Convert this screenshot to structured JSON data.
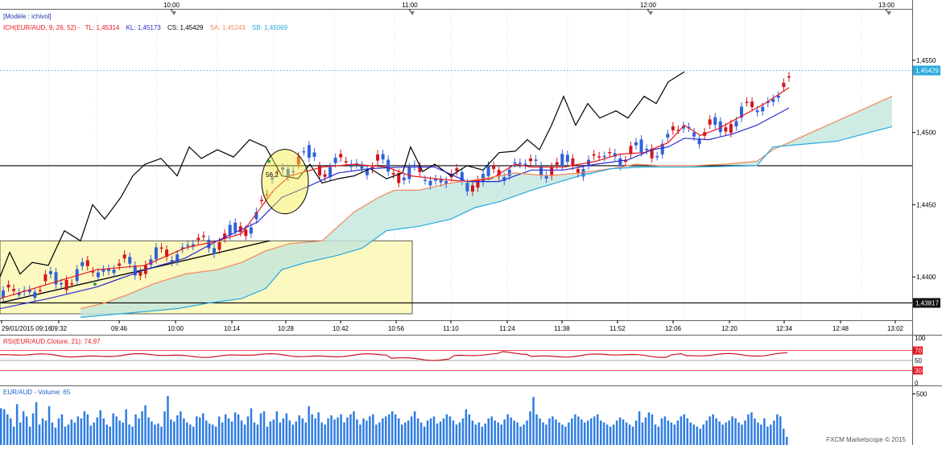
{
  "top_time_labels": [
    "10:00",
    "11:00",
    "12:00",
    "13:00"
  ],
  "legend": {
    "model": "[Modèle : ichivol]",
    "ich": "ICH(EUR/AUD, 9, 26, 52) -",
    "tl": "TL: 1,45314",
    "kl": "KL: 1,45173",
    "cs": "CS: 1,45429",
    "sa": "SA: 1,45243",
    "sb": "SB: 1,45069"
  },
  "price_axis": {
    "ticks": [
      "1,4550",
      "1,4500",
      "1,4450",
      "1,4400"
    ],
    "last_price_label": "1,45429",
    "level_label": "1,43817"
  },
  "bottom_time_labels": [
    "29/01/2015 09:16",
    "09:32",
    "09:46",
    "10:00",
    "10:14",
    "10:28",
    "10:42",
    "10:56",
    "11:10",
    "11:24",
    "11:38",
    "11:52",
    "12:06",
    "12:20",
    "12:34",
    "12:48",
    "13:02"
  ],
  "annotation": "56,2",
  "rsi": {
    "title": "RSI(EUR/AUD.Cloture, 21): 74,97",
    "levels": [
      "100",
      "70",
      "50",
      "30",
      "0"
    ]
  },
  "volume": {
    "title": "EUR/AUD - Volume: 65",
    "tick": "500"
  },
  "footer": "FXCM Marketscope © 2015",
  "colors": {
    "tenkan": "#e8141e",
    "kijun": "#2a2ad0",
    "chikou": "#000000",
    "senkou_a": "#f5875a",
    "senkou_b": "#29a9e0",
    "up_candle": "#2f62d8",
    "down_candle": "#d4141e",
    "volume": "#2f7de0",
    "highlight": "#fbf8c0"
  },
  "chart_data": {
    "type": "line",
    "symbol": "EUR/AUD",
    "date": "29/01/2015",
    "ylim": [
      1.437,
      1.4585
    ],
    "series": [
      {
        "name": "CS",
        "values": [
          [
            0,
            1.44
          ],
          [
            12,
            1.4417
          ],
          [
            25,
            1.4402
          ],
          [
            40,
            1.441
          ],
          [
            60,
            1.4408
          ],
          [
            80,
            1.4432
          ],
          [
            100,
            1.4425
          ],
          [
            115,
            1.445
          ],
          [
            130,
            1.444
          ],
          [
            150,
            1.4455
          ],
          [
            165,
            1.447
          ],
          [
            180,
            1.4478
          ],
          [
            200,
            1.4482
          ],
          [
            220,
            1.447
          ],
          [
            235,
            1.449
          ],
          [
            250,
            1.4482
          ],
          [
            270,
            1.4488
          ],
          [
            290,
            1.4483
          ],
          [
            310,
            1.4495
          ],
          [
            330,
            1.449
          ],
          [
            350,
            1.447
          ],
          [
            370,
            1.4468
          ],
          [
            385,
            1.4478
          ],
          [
            400,
            1.4465
          ],
          [
            420,
            1.4468
          ],
          [
            440,
            1.447
          ],
          [
            460,
            1.4475
          ],
          [
            480,
            1.4468
          ],
          [
            500,
            1.4472
          ],
          [
            510,
            1.449
          ],
          [
            525,
            1.4473
          ],
          [
            540,
            1.4478
          ],
          [
            560,
            1.447
          ],
          [
            580,
            1.4477
          ],
          [
            600,
            1.4474
          ],
          [
            620,
            1.4486
          ],
          [
            640,
            1.4487
          ],
          [
            655,
            1.4495
          ],
          [
            670,
            1.4488
          ],
          [
            685,
            1.4505
          ],
          [
            700,
            1.4525
          ],
          [
            715,
            1.4505
          ],
          [
            730,
            1.452
          ],
          [
            745,
            1.451
          ],
          [
            765,
            1.4515
          ],
          [
            780,
            1.451
          ],
          [
            800,
            1.4525
          ],
          [
            815,
            1.452
          ],
          [
            830,
            1.4535
          ],
          [
            850,
            1.4542
          ]
        ]
      },
      {
        "name": "TL",
        "values": [
          [
            0,
            1.4385
          ],
          [
            60,
            1.4395
          ],
          [
            120,
            1.4405
          ],
          [
            180,
            1.4408
          ],
          [
            230,
            1.442
          ],
          [
            270,
            1.4425
          ],
          [
            300,
            1.443
          ],
          [
            320,
            1.4445
          ],
          [
            340,
            1.446
          ],
          [
            360,
            1.447
          ],
          [
            400,
            1.4476
          ],
          [
            440,
            1.4478
          ],
          [
            480,
            1.4476
          ],
          [
            510,
            1.447
          ],
          [
            540,
            1.4468
          ],
          [
            580,
            1.4466
          ],
          [
            610,
            1.4468
          ],
          [
            640,
            1.4478
          ],
          [
            660,
            1.4476
          ],
          [
            700,
            1.4476
          ],
          [
            740,
            1.448
          ],
          [
            770,
            1.4485
          ],
          [
            800,
            1.4486
          ],
          [
            830,
            1.4493
          ],
          [
            850,
            1.4505
          ],
          [
            870,
            1.4498
          ],
          [
            890,
            1.4502
          ],
          [
            910,
            1.4508
          ],
          [
            930,
            1.4514
          ],
          [
            950,
            1.452
          ],
          [
            980,
            1.4531
          ]
        ]
      },
      {
        "name": "KL",
        "values": [
          [
            0,
            1.4378
          ],
          [
            60,
            1.4385
          ],
          [
            120,
            1.4393
          ],
          [
            180,
            1.4405
          ],
          [
            230,
            1.4413
          ],
          [
            270,
            1.4425
          ],
          [
            320,
            1.4438
          ],
          [
            350,
            1.4455
          ],
          [
            380,
            1.4462
          ],
          [
            420,
            1.4472
          ],
          [
            460,
            1.4475
          ],
          [
            500,
            1.4476
          ],
          [
            540,
            1.4476
          ],
          [
            580,
            1.4466
          ],
          [
            620,
            1.4466
          ],
          [
            660,
            1.4474
          ],
          [
            700,
            1.4474
          ],
          [
            740,
            1.4478
          ],
          [
            780,
            1.4481
          ],
          [
            810,
            1.4488
          ],
          [
            830,
            1.449
          ],
          [
            850,
            1.4496
          ],
          [
            880,
            1.4495
          ],
          [
            910,
            1.4499
          ],
          [
            940,
            1.4505
          ],
          [
            980,
            1.4517
          ]
        ]
      },
      {
        "name": "SA",
        "values": [
          [
            100,
            1.4378
          ],
          [
            130,
            1.4382
          ],
          [
            160,
            1.4388
          ],
          [
            190,
            1.4395
          ],
          [
            230,
            1.4402
          ],
          [
            270,
            1.4405
          ],
          [
            300,
            1.441
          ],
          [
            330,
            1.4418
          ],
          [
            360,
            1.4423
          ],
          [
            400,
            1.4425
          ],
          [
            440,
            1.4445
          ],
          [
            470,
            1.4455
          ],
          [
            490,
            1.446
          ],
          [
            520,
            1.446
          ],
          [
            560,
            1.4465
          ],
          [
            600,
            1.4468
          ],
          [
            640,
            1.4472
          ],
          [
            680,
            1.447
          ],
          [
            720,
            1.4472
          ],
          [
            760,
            1.4475
          ],
          [
            790,
            1.4478
          ],
          [
            820,
            1.4477
          ],
          [
            860,
            1.4477
          ],
          [
            900,
            1.4478
          ],
          [
            940,
            1.448
          ],
          [
            960,
            1.4488
          ],
          [
            1000,
            1.4498
          ],
          [
            1040,
            1.4508
          ],
          [
            1080,
            1.4518
          ],
          [
            1108,
            1.4525
          ]
        ]
      },
      {
        "name": "SB",
        "values": [
          [
            100,
            1.4372
          ],
          [
            160,
            1.4375
          ],
          [
            220,
            1.4378
          ],
          [
            260,
            1.4382
          ],
          [
            300,
            1.4385
          ],
          [
            330,
            1.4392
          ],
          [
            350,
            1.4405
          ],
          [
            380,
            1.441
          ],
          [
            420,
            1.4415
          ],
          [
            450,
            1.442
          ],
          [
            480,
            1.4432
          ],
          [
            520,
            1.4435
          ],
          [
            560,
            1.444
          ],
          [
            590,
            1.4448
          ],
          [
            620,
            1.4452
          ],
          [
            660,
            1.446
          ],
          [
            690,
            1.4465
          ],
          [
            720,
            1.447
          ],
          [
            760,
            1.4475
          ],
          [
            800,
            1.4476
          ],
          [
            860,
            1.4476
          ],
          [
            940,
            1.4477
          ],
          [
            960,
            1.449
          ],
          [
            1000,
            1.4492
          ],
          [
            1040,
            1.4494
          ],
          [
            1080,
            1.45
          ],
          [
            1108,
            1.4504
          ]
        ]
      }
    ],
    "price_levels": [
      1.4477,
      1.4382
    ],
    "rsi_value": 74.97,
    "rsi_levels": [
      100,
      70,
      50,
      30,
      0
    ],
    "volume_last": 65,
    "volume_values": [
      360,
      350,
      300,
      260,
      180,
      400,
      220,
      330,
      280,
      180,
      310,
      420,
      200,
      260,
      240,
      380,
      220,
      170,
      260,
      300,
      180,
      200,
      250,
      220,
      280,
      260,
      330,
      300,
      190,
      220,
      270,
      340,
      260,
      200,
      180,
      310,
      280,
      240,
      220,
      350,
      200,
      180,
      300,
      260,
      330,
      390,
      270,
      230,
      200,
      210,
      180,
      330,
      480,
      250,
      230,
      290,
      330,
      260,
      220,
      200,
      180,
      280,
      270,
      310,
      240,
      210,
      200,
      180,
      280,
      220,
      300,
      260,
      230,
      320,
      300,
      240,
      200,
      280,
      360,
      220,
      200,
      310,
      330,
      180,
      230,
      250,
      330,
      220,
      260,
      310,
      240,
      200,
      230,
      290,
      260,
      220,
      380,
      300,
      260,
      320,
      220,
      200,
      260,
      290,
      250,
      270,
      300,
      220,
      270,
      300,
      330,
      250,
      200,
      260,
      240,
      280,
      300,
      200,
      220,
      260,
      280,
      300,
      330,
      300,
      260,
      200,
      220,
      240,
      280,
      330,
      260,
      220,
      180,
      240,
      260,
      280,
      210,
      230,
      260,
      300,
      280,
      240,
      200,
      220,
      260,
      350,
      300,
      240,
      200,
      220,
      180,
      210,
      260,
      280,
      240,
      220,
      200,
      250,
      300,
      270,
      240,
      220,
      180,
      200,
      240,
      330,
      470,
      300,
      260,
      220,
      200,
      260,
      280,
      250,
      220,
      200,
      180,
      220,
      260,
      300,
      280,
      250,
      220,
      240,
      260,
      280,
      300,
      240,
      220,
      200,
      180,
      200,
      240,
      270,
      250,
      220,
      200,
      180,
      240,
      330,
      220,
      270,
      320,
      300,
      200,
      180,
      260,
      280,
      240,
      220,
      200,
      240,
      280,
      300,
      260,
      220,
      200,
      180,
      160,
      200,
      240,
      280,
      300,
      260,
      230,
      200,
      220,
      240,
      280,
      260,
      220,
      200,
      240,
      300,
      320,
      260,
      220,
      200,
      260,
      180,
      200,
      240,
      300,
      280,
      160,
      80
    ]
  }
}
